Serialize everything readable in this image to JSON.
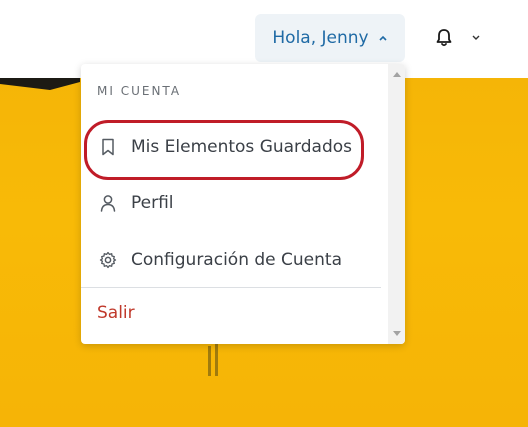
{
  "header": {
    "greeting": "Hola, Jenny"
  },
  "menu": {
    "section_title": "MI CUENTA",
    "items": [
      {
        "label": "Mis Elementos Guardados",
        "icon": "bookmark-icon"
      },
      {
        "label": "Perfil",
        "icon": "user-icon"
      },
      {
        "label": "Configuración de Cuenta",
        "icon": "gear-icon"
      }
    ],
    "logout_label": "Salir"
  },
  "colors": {
    "accent": "#1f6aa5",
    "logout": "#c0392b",
    "highlight": "#c01c28",
    "hero": "#f8ba07"
  }
}
